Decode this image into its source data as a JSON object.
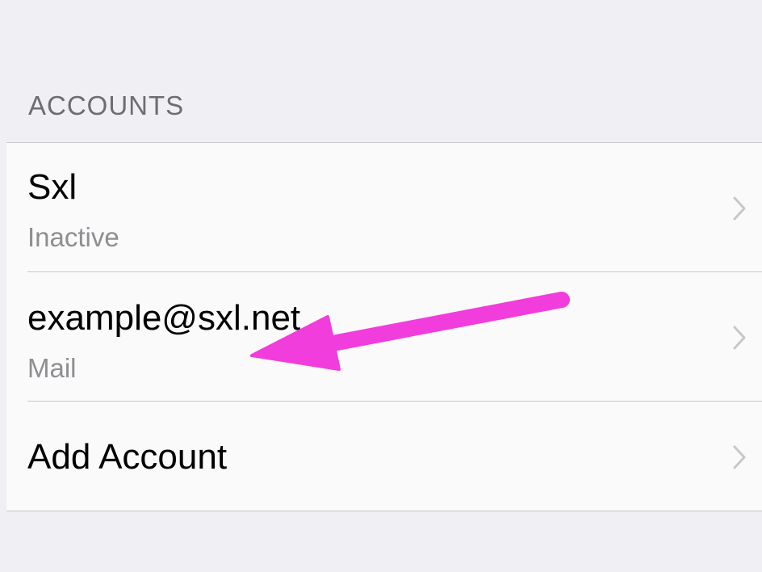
{
  "accounts": {
    "section_header": "ACCOUNTS",
    "items": [
      {
        "title": "Sxl",
        "subtitle": "Inactive"
      },
      {
        "title": "example@sxl.net",
        "subtitle": "Mail"
      },
      {
        "title": "Add Account"
      }
    ]
  },
  "colors": {
    "background": "#efeff4",
    "cell_background": "#fafafa",
    "separator": "#c8c7cc",
    "secondary_text": "#8e8e93",
    "section_header_text": "#6d6d72",
    "chevron": "#c7c7cc",
    "annotation_arrow": "#f03ddc"
  },
  "icons": {
    "row_disclosure": "chevron-right-icon",
    "annotation": "arrow-annotation-icon"
  }
}
